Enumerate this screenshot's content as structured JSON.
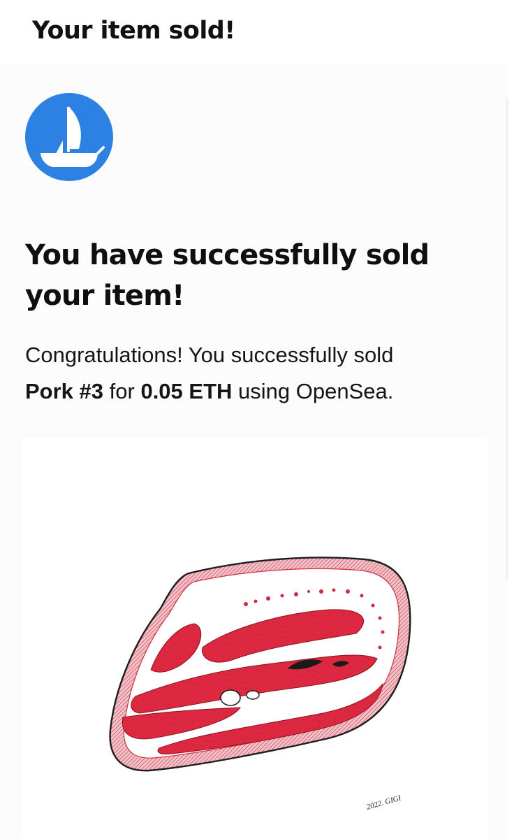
{
  "email": {
    "subject": "Your item sold!"
  },
  "content": {
    "headline": "You have successfully sold your item!",
    "message": {
      "prefix": "Congratulations! You successfully sold",
      "item_name": "Pork #3",
      "for_text": "for",
      "price": "0.05 ETH",
      "suffix": "using OpenSea."
    }
  },
  "image": {
    "signature": "2022. GIGI"
  },
  "icons": {
    "logo": "opensea-ship-icon"
  },
  "colors": {
    "brand_blue": "#2d81e2",
    "meat_red": "#d52a3d",
    "rind_pink": "#f1a8b2"
  }
}
